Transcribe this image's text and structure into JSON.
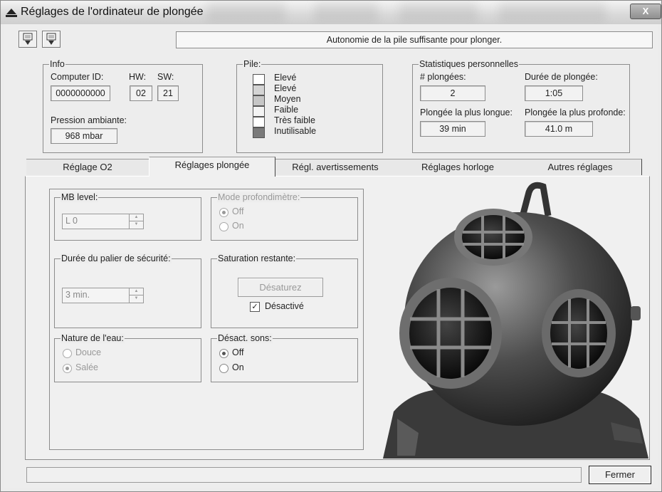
{
  "window": {
    "title": "Réglages de l'ordinateur de plongée",
    "close_label": "X"
  },
  "toolbar": {
    "download_icon": "download-icon",
    "upload_icon": "upload-icon"
  },
  "status_message": "Autonomie de la pile suffisante pour plonger.",
  "info": {
    "legend": "Info",
    "computer_id_label": "Computer ID:",
    "computer_id_value": "0000000000",
    "hw_label": "HW:",
    "hw_value": "02",
    "sw_label": "SW:",
    "sw_value": "21",
    "pression_label": "Pression ambiante:",
    "pression_value": "968 mbar"
  },
  "pile": {
    "legend": "Pile:",
    "levels": [
      {
        "label": "Elevé",
        "color": "#ffffff"
      },
      {
        "label": "Elevé",
        "color": "#d4d4d4"
      },
      {
        "label": "Moyen",
        "color": "#c6c6c6"
      },
      {
        "label": "Faible",
        "color": "#f4f4f4"
      },
      {
        "label": "Très faible",
        "color": "#ffffff"
      },
      {
        "label": "Inutilisable",
        "color": "#7a7a7a"
      }
    ]
  },
  "stats": {
    "legend": "Statistiques personnelles",
    "plongees_label": "# plongées:",
    "plongees_value": "2",
    "duree_label": "Durée de plongée:",
    "duree_value": "1:05",
    "longue_label": "Plongée la plus longue:",
    "longue_value": "39 min",
    "profonde_label": "Plongée la plus profonde:",
    "profonde_value": "41.0 m"
  },
  "tabs": [
    "Réglage O2",
    "Réglages plongée",
    "Régl. avertissements",
    "Réglages horloge",
    "Autres réglages"
  ],
  "active_tab": "Réglages plongée",
  "mb_level": {
    "legend": "MB level:",
    "value": "L 0"
  },
  "mode_profondimetre": {
    "legend": "Mode profondimètre:",
    "options": [
      "Off",
      "On"
    ],
    "selected": "Off"
  },
  "palier": {
    "legend": "Durée du palier de sécurité:",
    "value": "3 min."
  },
  "saturation": {
    "legend": "Saturation restante:",
    "button_label": "Désaturez",
    "checkbox_label": "Désactivé",
    "checked": true
  },
  "nature_eau": {
    "legend": "Nature de l'eau:",
    "options": [
      "Douce",
      "Salée"
    ],
    "selected": "Salée"
  },
  "desact_sons": {
    "legend": "Désact. sons:",
    "options": [
      "Off",
      "On"
    ],
    "selected": "Off"
  },
  "footer": {
    "close_button": "Fermer"
  }
}
